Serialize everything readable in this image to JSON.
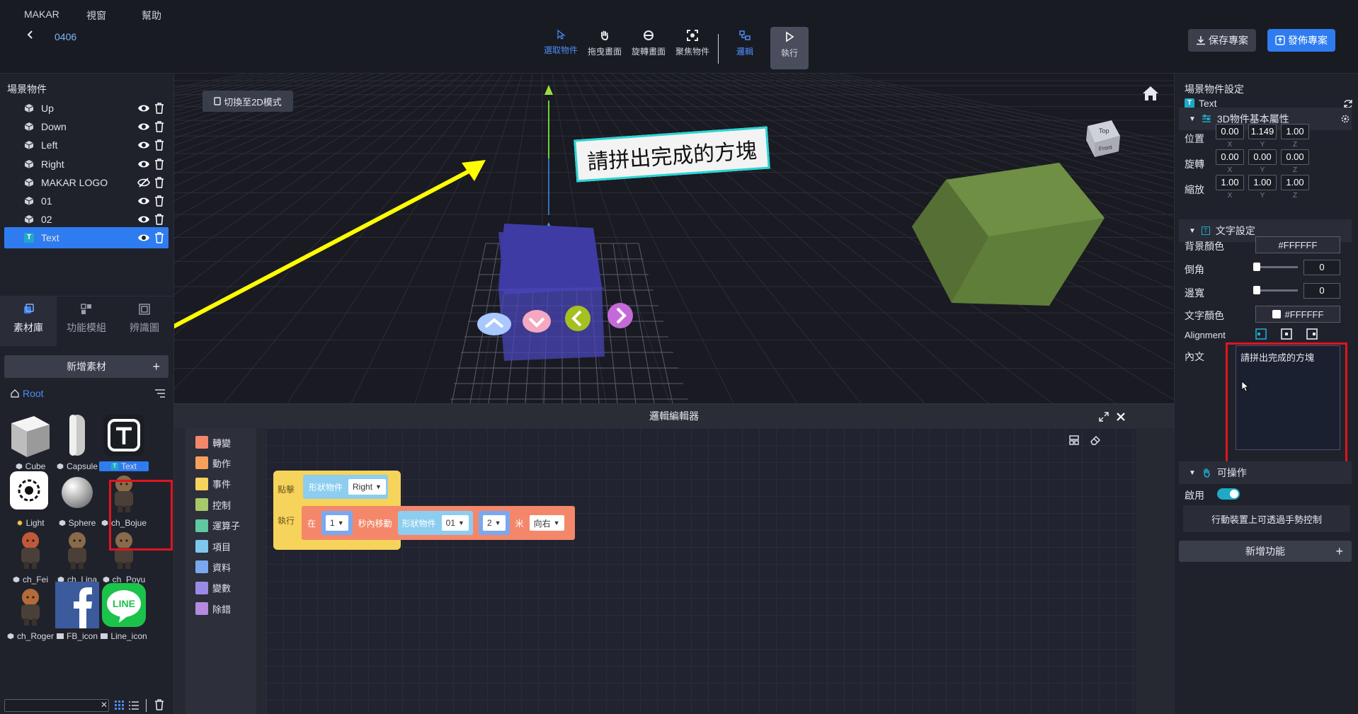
{
  "menu": [
    "MAKAR",
    "視窗",
    "幫助"
  ],
  "project": {
    "name": "0406"
  },
  "toolbar": {
    "select": "選取物件",
    "pan": "拖曳畫面",
    "rotate": "旋轉畫面",
    "focus": "聚焦物件",
    "logic": "邏輯",
    "run": "執行",
    "save": "保存專案",
    "publish": "發佈專案"
  },
  "scene": {
    "title": "場景物件",
    "objects": [
      {
        "name": "Up",
        "visible": true
      },
      {
        "name": "Down",
        "visible": true
      },
      {
        "name": "Left",
        "visible": true
      },
      {
        "name": "Right",
        "visible": true
      },
      {
        "name": "MAKAR LOGO",
        "visible": false
      },
      {
        "name": "01",
        "visible": true
      },
      {
        "name": "02",
        "visible": true
      },
      {
        "name": "Text",
        "visible": true,
        "selected": true
      }
    ]
  },
  "left_tabs": [
    "素材庫",
    "功能模組",
    "辨識圖"
  ],
  "assets": {
    "add_label": "新增素材",
    "root": "Root",
    "items": [
      "Cube",
      "Capsule",
      "Text",
      "Light",
      "Sphere",
      "ch_Bojue",
      "ch_Fei",
      "ch_Lina",
      "ch_Poyu",
      "ch_Roger",
      "FB_icon",
      "Line_icon"
    ],
    "line_logo_text": "LINE"
  },
  "viewport": {
    "switch_2d": "切換至2D模式",
    "text_label": "請拼出完成的方塊",
    "viewcube_top": "Top",
    "viewcube_front": "Front"
  },
  "logic_editor": {
    "title": "邏輯編輯器",
    "categories": [
      {
        "label": "轉變",
        "color": "#f4876a"
      },
      {
        "label": "動作",
        "color": "#f6a05a"
      },
      {
        "label": "事件",
        "color": "#f6d35a"
      },
      {
        "label": "控制",
        "color": "#a6c96a"
      },
      {
        "label": "運算子",
        "color": "#5fc8a0"
      },
      {
        "label": "項目",
        "color": "#7ec8f0"
      },
      {
        "label": "資料",
        "color": "#7aa8f0"
      },
      {
        "label": "變數",
        "color": "#9a8ae8"
      },
      {
        "label": "除錯",
        "color": "#b58ae0"
      }
    ],
    "blocks": {
      "click": "點擊",
      "shape_object": "形狀物件",
      "click_target": "Right",
      "execute": "執行",
      "in": "在",
      "seconds": "1",
      "seconds_move": "秒內移動",
      "move_shape": "形狀物件",
      "move_target": "01",
      "distance": "2",
      "meters": "米",
      "direction": "向右"
    }
  },
  "props": {
    "title": "場景物件設定",
    "object_name": "Text",
    "basic_section": "3D物件基本屬性",
    "position_label": "位置",
    "rotation_label": "旋轉",
    "scale_label": "縮放",
    "position": [
      "0.00",
      "1.149",
      "1.00"
    ],
    "rotation": [
      "0.00",
      "0.00",
      "0.00"
    ],
    "scale": [
      "1.00",
      "1.00",
      "1.00"
    ],
    "axes": [
      "X",
      "Y",
      "Z"
    ],
    "text_section": "文字設定",
    "bg_color_label": "背景顏色",
    "bg_color": "#FFFFFF",
    "corner_label": "倒角",
    "corner": "0",
    "border_label": "邊寬",
    "border": "0",
    "text_color_label": "文字顏色",
    "text_color": "#FFFFFF",
    "alignment_label": "Alignment",
    "content_label": "內文",
    "content": "請拼出完成的方塊",
    "interactive_section": "可操作",
    "enable_label": "啟用",
    "gesture_label": "行動裝置上可透過手勢控制",
    "add_function": "新增功能"
  },
  "colors": {
    "accent": "#2f7cf0",
    "highlight": "#e0141f",
    "toggle": "#1fa9c9"
  }
}
